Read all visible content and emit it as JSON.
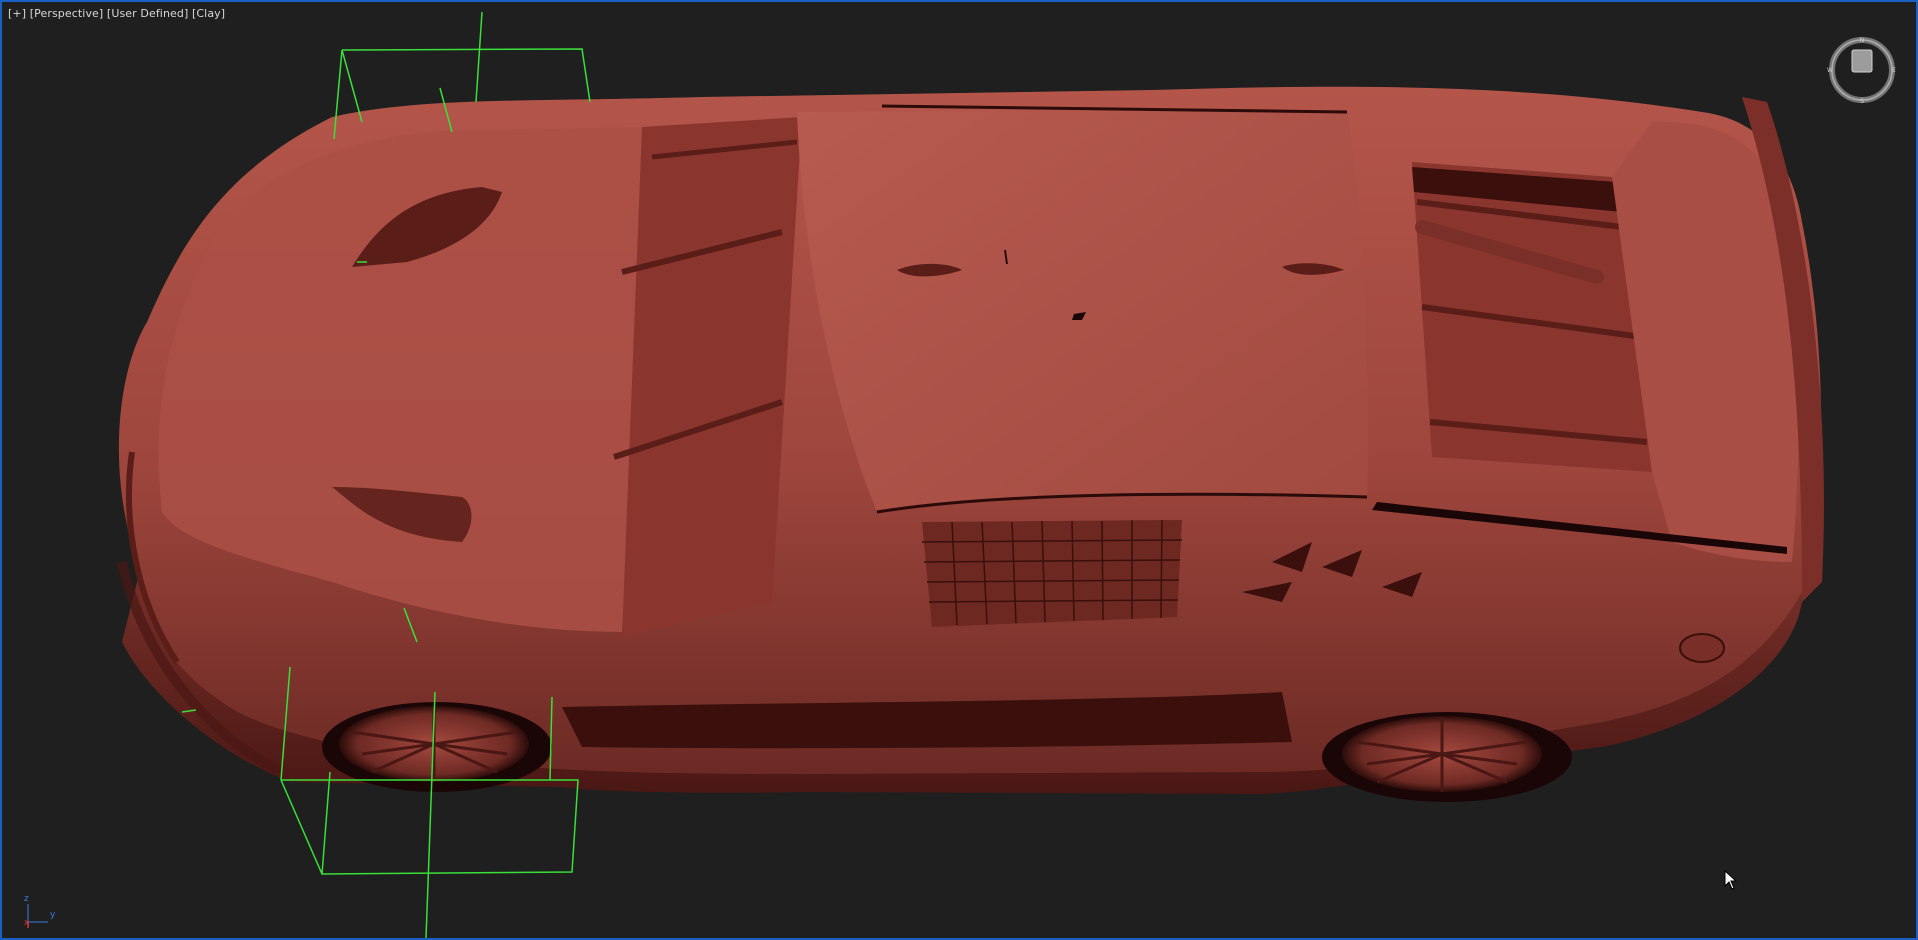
{
  "viewport": {
    "label_plus": "[+]",
    "label_view": "[Perspective]",
    "label_camera": "[User Defined]",
    "label_shading": "[Clay]"
  },
  "axis_tripod": {
    "x": "x",
    "y": "y",
    "z": "z"
  },
  "viewcube": {
    "north": "N",
    "south": "S",
    "east": "E",
    "west": "W",
    "face": "top",
    "icon": "viewcube-icon"
  },
  "colors": {
    "background": "#1f1f1f",
    "clay": "#a1493f",
    "selection_bbox": "#39e03a",
    "viewport_border": "#1a5fc4"
  }
}
